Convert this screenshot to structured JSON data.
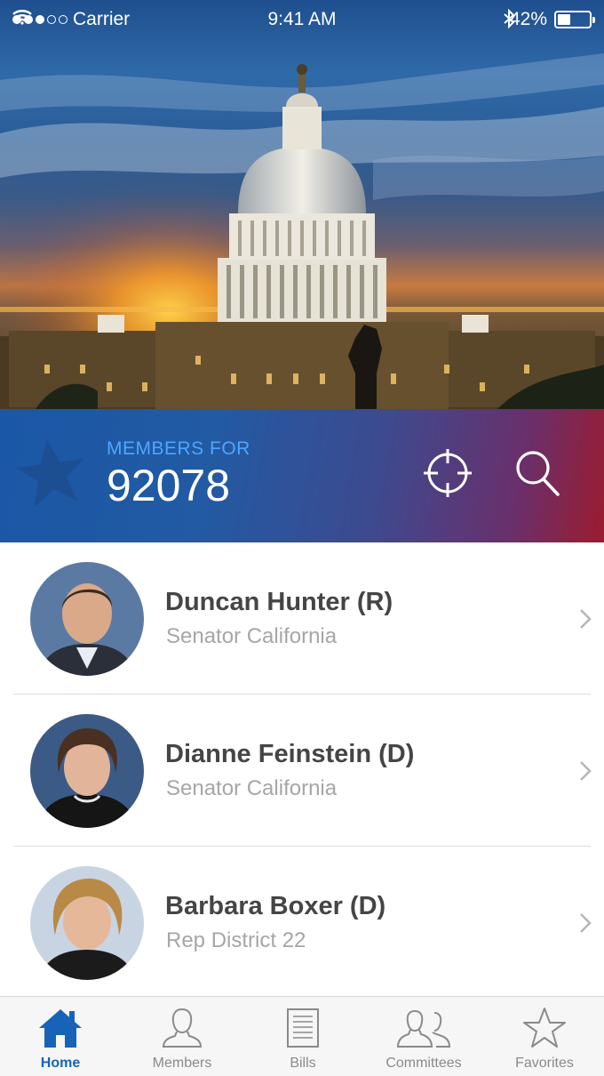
{
  "status_bar": {
    "carrier": "Carrier",
    "time": "9:41 AM",
    "battery": "42%",
    "battery_level": 0.42,
    "signal_bars": 3,
    "signal_total": 5
  },
  "hero": {
    "image": "capitol-building-sunset"
  },
  "banner": {
    "label": "MEMBERS FOR",
    "zip": "92078",
    "accent_color": "#4ea6ff",
    "icons": {
      "locate": "crosshair-icon",
      "search": "search-icon",
      "decor": "star-icon"
    }
  },
  "members": [
    {
      "name": "Duncan Hunter (R)",
      "role": "Senator California"
    },
    {
      "name": "Dianne Feinstein (D)",
      "role": "Senator California"
    },
    {
      "name": "Barbara Boxer (D)",
      "role": "Rep District 22"
    }
  ],
  "tabs": [
    {
      "label": "Home",
      "icon": "house-icon",
      "active": true
    },
    {
      "label": "Members",
      "icon": "person-icon",
      "active": false
    },
    {
      "label": "Bills",
      "icon": "document-icon",
      "active": false
    },
    {
      "label": "Committees",
      "icon": "people-icon",
      "active": false
    },
    {
      "label": "Favorites",
      "icon": "star-icon",
      "active": false
    }
  ],
  "colors": {
    "active_tab": "#1863b8",
    "inactive_tab": "#8a8a8a",
    "name_text": "#454545",
    "role_text": "#a6a6a6"
  }
}
